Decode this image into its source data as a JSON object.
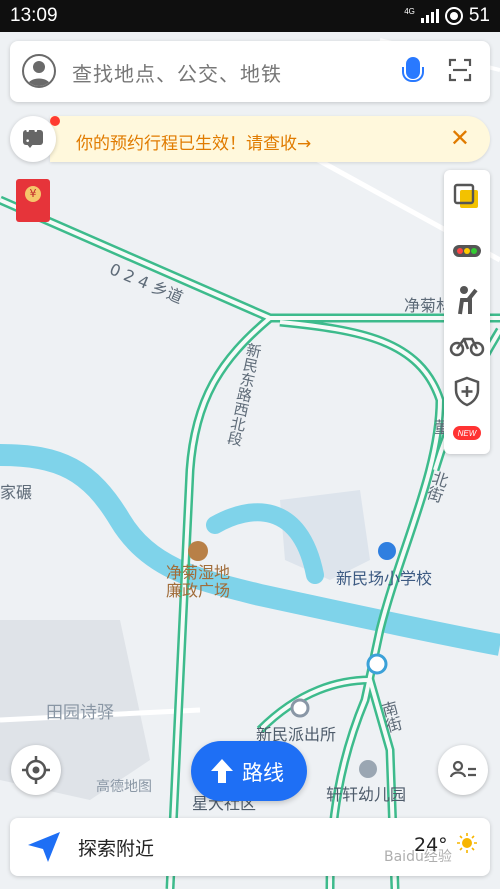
{
  "status_bar": {
    "time": "13:09",
    "network": "4G",
    "battery": "51"
  },
  "search": {
    "placeholder": "查找地点、公交、地铁"
  },
  "notice": {
    "text": "你的预约行程已生效！请查收→",
    "close": "✕"
  },
  "map_labels": {
    "road_024": "0 2 4 乡道",
    "xinmin_east_rd": "新民东路西北段",
    "jingju_top": "净菊林",
    "jiaxian": "家碾",
    "poi_park": "净菊湿地廉政广场",
    "school": "新民场小学校",
    "police": "新民派出所",
    "tianyuan": "田园诗驿",
    "kindergarten": "轩轩幼儿园",
    "north_street": "北街",
    "south_street": "南街",
    "edge_right": "董",
    "bottom_community": "星大社区",
    "logo": "高德地图"
  },
  "route_button": {
    "label": "路线"
  },
  "bottom": {
    "explore": "探索附近",
    "temperature": "24°"
  },
  "watermark": "Baidu经验",
  "colors": {
    "accent": "#1e6ff5",
    "road": "#3dbb8c",
    "river": "#7fd3ea"
  }
}
